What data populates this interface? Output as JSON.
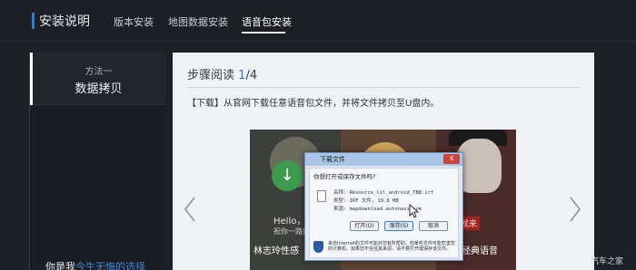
{
  "header": {
    "title": "安装说明",
    "tabs": [
      {
        "label": "版本安装"
      },
      {
        "label": "地图数据安装"
      },
      {
        "label": "语音包安装"
      }
    ]
  },
  "sidebar": {
    "method": "方法一",
    "method_name": "数据拷贝",
    "bottom_text_a": "你是我",
    "bottom_text_b": "今生无悔的选择"
  },
  "content": {
    "step_label": "步骤阅读",
    "step_current": "1",
    "step_total": "/4",
    "description": "【下载】从官网下载任意语音包文件，并将文件拷贝至U盘内。"
  },
  "screenshot": {
    "tile1_hello": "Hello，我是",
    "tile1_sub": "祝你一路好",
    "tile1_caption": "林志玲性感",
    "tile3_caption": "经典语音",
    "tile3_label": "张口就来",
    "dialog": {
      "title": "下载文件",
      "close": "X",
      "question": "你想打开或保存文件吗?",
      "name_line": "名称: Resource_lzl_android_TBB.irf",
      "type_line": "类型: IRF 文件, 19.8 MB",
      "source_line": "来源: mapdownload.autonavi.com",
      "btn_open": "打开(O)",
      "btn_save": "保存(S)",
      "btn_cancel": "取消",
      "note": "来自Internet的文件可能对您有所帮助，但某些文件可能危害您的计算机。如果您不信任其来源，请不要打开或保存该文件。"
    }
  },
  "watermark": "汽车之家",
  "colors": {
    "accent": "#2f7cd6",
    "background": "#1e2026",
    "panel": "#f1f2f5"
  }
}
